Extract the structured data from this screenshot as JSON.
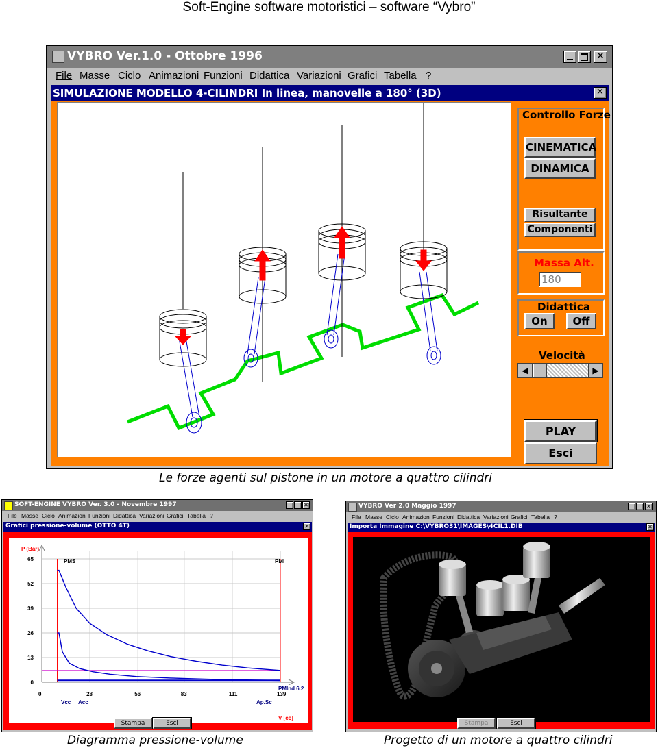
{
  "page": {
    "header": "Soft-Engine software motoristici – software “Vybro”",
    "caption_top": "Le forze agenti sul pistone in un motore a quattro cilindri",
    "caption_left": "Diagramma pressione-volume",
    "caption_right": "Progetto di un motore a quattro cilindri"
  },
  "main_window": {
    "title": "VYBRO Ver.1.0 - Ottobre 1996",
    "menu": [
      "File",
      "Masse",
      "Ciclo",
      "Animazioni",
      "Funzioni",
      "Didattica",
      "Variazioni",
      "Grafici",
      "Tabella",
      "?"
    ],
    "sub_title": "SIMULAZIONE MODELLO 4-CILINDRI In linea, manovelle a 180° (3D)",
    "colors": {
      "frame": "#ff8000",
      "crank": "#00dd00",
      "force": "#ff0000",
      "rod": "#0000cc"
    },
    "controls": {
      "group_title": "Controllo Forze",
      "cinematica": "CINEMATICA",
      "dinamica": "DINAMICA",
      "risultante": "Risultante",
      "componenti": "Componenti",
      "massa_label": "Massa Alt.",
      "massa_value": "180",
      "didattica_label": "Didattica",
      "on": "On",
      "off": "Off",
      "velocita_label": "Velocità",
      "play": "PLAY",
      "esci": "Esci"
    }
  },
  "pv_window": {
    "title": "SOFT-ENGINE    VYBRO Ver. 3.0 - Novembre 1997",
    "menu": [
      "File",
      "Masse",
      "Ciclo",
      "Animazioni",
      "Funzioni",
      "Didattica",
      "Variazioni",
      "Grafici",
      "Tabella",
      "?"
    ],
    "sub_title": "Grafici pressione-volume (OTTO 4T)",
    "stampa": "Stampa",
    "esci": "Esci"
  },
  "img_window": {
    "title": "VYBRO Ver 2.0  Maggio 1997",
    "menu": [
      "File",
      "Masse",
      "Ciclo",
      "Animazioni",
      "Funzioni",
      "Didattica",
      "Variazioni",
      "Grafici",
      "Tabella",
      "?"
    ],
    "sub_title": "Importa Immagine  C:\\VYBRO31\\IMAGES\\4CIL1.DIB",
    "stampa": "Stampa",
    "esci": "Esci"
  },
  "chart_data": {
    "type": "line",
    "title": "",
    "xlabel": "V [cc]",
    "ylabel": "P (Bar)",
    "x_ticks": [
      0,
      28,
      56,
      83,
      111,
      139
    ],
    "y_ticks": [
      0,
      13,
      26,
      39,
      52,
      65
    ],
    "xlim": [
      0,
      139
    ],
    "ylim": [
      0,
      65
    ],
    "annotations": [
      "PMS",
      "PMI",
      "Vcc",
      "Acc",
      "Ap.Sc",
      "PMInd 6.2"
    ],
    "series": [
      {
        "values_x": [
          9,
          10,
          14,
          20,
          28,
          38,
          50,
          62,
          75,
          90,
          105,
          120,
          139
        ],
        "values_y": [
          59,
          59,
          50,
          39,
          31,
          25,
          20,
          16.5,
          13.5,
          11,
          9,
          7.5,
          6.2
        ]
      },
      {
        "values_x": [
          9,
          10,
          12,
          16,
          22,
          30,
          40,
          55,
          75,
          100,
          125,
          139
        ],
        "values_y": [
          26,
          26,
          16,
          10,
          7.2,
          5.5,
          4.2,
          3,
          2.2,
          1.5,
          1.1,
          0.9
        ]
      },
      {
        "values_x": [
          9,
          139
        ],
        "values_y": [
          1,
          1
        ]
      }
    ],
    "reference_line_y": 6.2
  }
}
